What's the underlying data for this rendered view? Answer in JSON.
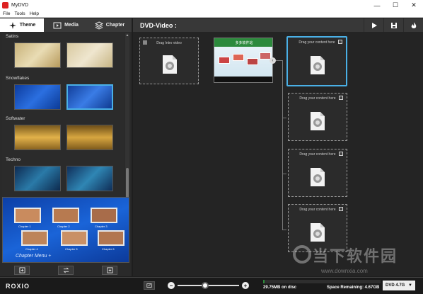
{
  "window": {
    "title": "MyDVD",
    "minimize": "—",
    "maximize": "☐",
    "close": "✕"
  },
  "menu": [
    "File",
    "Tools",
    "Help"
  ],
  "left_tabs": [
    {
      "label": "Theme",
      "icon": "theme-icon",
      "active": true
    },
    {
      "label": "Media",
      "icon": "film-icon",
      "active": false
    },
    {
      "label": "Chapter",
      "icon": "chapter-icon",
      "active": false
    }
  ],
  "theme_groups": [
    {
      "name": "Satins"
    },
    {
      "name": "Snowflakes"
    },
    {
      "name": "Softwater"
    },
    {
      "name": "Techno"
    }
  ],
  "preview": {
    "menu_label": "Chapter Menu +",
    "chapters": [
      "Chapter 1",
      "Chapter 2",
      "Chapter 3",
      "Chapter 4",
      "Chapter 5",
      "Chapter 6"
    ]
  },
  "left_buttons": [
    "import-theme-icon",
    "swap-icon",
    "add-icon"
  ],
  "main": {
    "title": "DVD-Video :",
    "header_buttons": [
      "play-icon",
      "save-icon",
      "burn-icon"
    ],
    "intro_label": "Drag Intro video",
    "menu_thumb_title": "多多软件站",
    "nav_arrow": "‹",
    "content_label": "Drag your content here"
  },
  "bottom": {
    "logo": "ROXIO",
    "zoom_minus": "−",
    "zoom_plus": "+",
    "zoom_level": 0.45,
    "disc_usage": "29.75MB on disc",
    "space_remaining": "Space Remaining: 4.67GB",
    "disc_type": "DVD 4.7G",
    "disc_fill_fraction": 0.01
  },
  "watermark": {
    "brand": "当下软件园",
    "url": "www.downxia.com"
  },
  "colors": {
    "accent": "#4ab0e6",
    "panel": "#2a2a2a",
    "burn": "#ffffff"
  }
}
